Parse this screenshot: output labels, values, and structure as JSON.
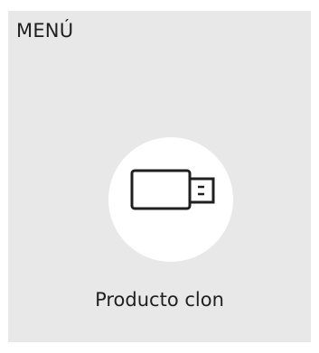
{
  "menu": {
    "title": "MENÚ"
  },
  "item": {
    "label": "Producto clon",
    "icon": "usb-drive-icon"
  }
}
